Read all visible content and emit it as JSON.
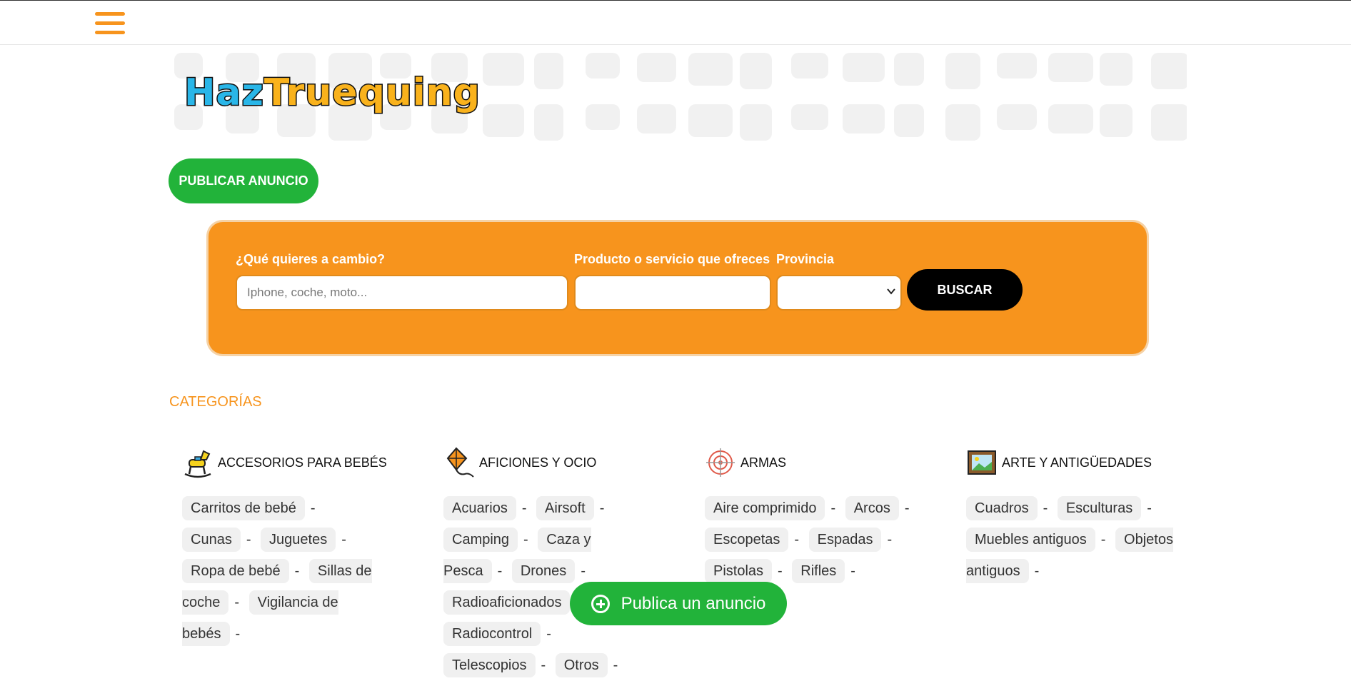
{
  "header": {
    "menu_icon": "hamburger-menu-icon"
  },
  "banner": {
    "logo_part1": "Haz",
    "logo_part2": "Truequing"
  },
  "publish_button": "PUBLICAR ANUNCIO",
  "search": {
    "label_want": "¿Qué quieres a cambio?",
    "placeholder_want": "Iphone, coche, moto...",
    "label_offer": "Producto o servicio que ofreces",
    "label_province": "Provincia",
    "province_value": "",
    "button": "BUSCAR"
  },
  "categories": {
    "title": "CATEGORÍAS",
    "columns": [
      {
        "icon": "rocking-horse-icon",
        "name": "ACCESORIOS PARA BEBÉS",
        "items": [
          "Carritos de bebé",
          "Cunas",
          "Juguetes",
          "Ropa de bebé",
          "Sillas de coche",
          "Vigilancia de bebés"
        ]
      },
      {
        "icon": "kite-icon",
        "name": "AFICIONES Y OCIO",
        "items": [
          "Acuarios",
          "Airsoft",
          "Camping",
          "Caza y Pesca",
          "Drones",
          "Radioaficionados",
          "Radiocontrol",
          "Telescopios",
          "Otros"
        ]
      },
      {
        "icon": "target-icon",
        "name": "ARMAS",
        "items": [
          "Aire comprimido",
          "Arcos",
          "Escopetas",
          "Espadas",
          "Pistolas",
          "Rifles"
        ]
      },
      {
        "icon": "framed-picture-icon",
        "name": "ARTE Y ANTIGÜEDADES",
        "items": [
          "Cuadros",
          "Esculturas",
          "Muebles antiguos",
          "Objetos antiguos"
        ]
      }
    ]
  },
  "fab": {
    "label": "Publica un anuncio",
    "icon": "plus-circle-icon"
  },
  "colors": {
    "orange": "#f7941d",
    "green": "#22b33a",
    "black": "#000000"
  }
}
